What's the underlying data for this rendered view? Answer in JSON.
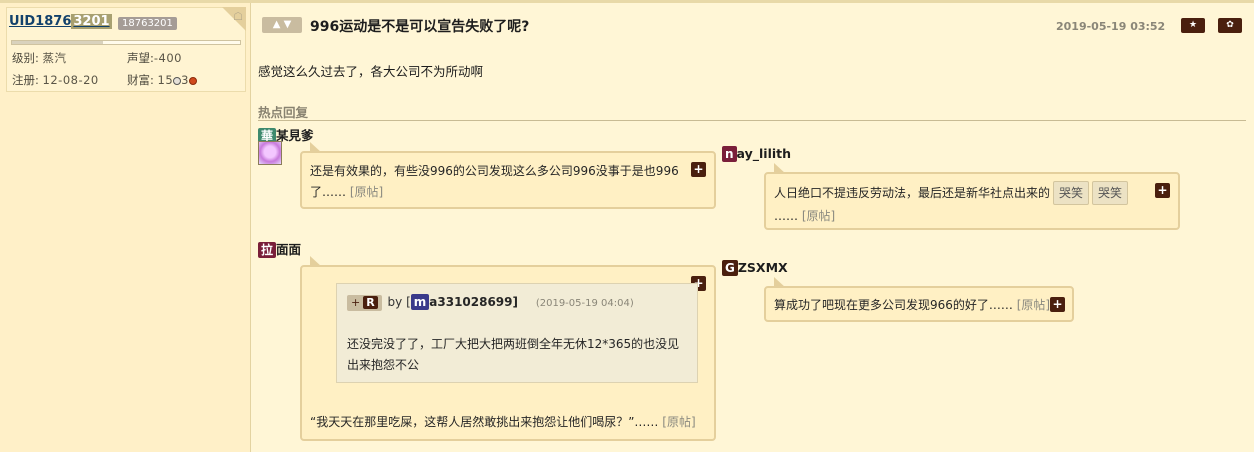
{
  "user": {
    "uid_prefix": "UID1876",
    "uid_highlight": "3201",
    "uid_badge": "18763201",
    "level_label": "级别:",
    "level_value": "蒸汽",
    "rep_label": "声望:",
    "rep_value": "-400",
    "reg_label": "注册:",
    "reg_value": "12-08-20",
    "wealth_label": "财富:",
    "wealth_a": "15",
    "wealth_b": "3",
    "exp_fraction": 0.4
  },
  "post": {
    "title": "996运动是不是可以宣告失败了呢?",
    "time": "2019-05-19 03:52",
    "content": "感觉这么久过去了，各大公司不为所动啊"
  },
  "hot_section": {
    "label": "热点回复"
  },
  "replies": [
    {
      "tag": "華",
      "tag_color": "#3e8a6e",
      "name": "某見爹",
      "text": "还是有效果的，有些没996的公司发现这么多公司996没事于是也996了……",
      "orig": "[原帖]"
    },
    {
      "tag": "n",
      "tag_color": "#7a1f3a",
      "name": "ay_lilith",
      "text": "人日绝口不提违反劳动法，最后还是新华社点出来的",
      "emo1": "哭笑",
      "emo2": "哭笑",
      "tail": "……",
      "orig": "[原帖]"
    },
    {
      "tag": "拉",
      "tag_color": "#7a1f3a",
      "name": "面面",
      "quote": {
        "plus": "+",
        "r": "R",
        "by": "by [",
        "tag": "m",
        "tag_color": "#3a3a8a",
        "user": "a331028699]",
        "time": "(2019-05-19 04:04)",
        "text": "还没完没了了，工厂大把大把两班倒全年无休12*365的也没见出来抱怨不公"
      },
      "text": "“我天天在那里吃屎，这帮人居然敢挑出来抱怨让他们喝尿？”……",
      "orig": "[原帖]"
    },
    {
      "tag": "G",
      "tag_color": "#4a1f0e",
      "name": "ZSXMX",
      "text": "算成功了吧现在更多公司发现966的好了……",
      "orig": "[原帖]"
    }
  ],
  "icons": {
    "plus": "+",
    "star": "★",
    "gear": "✿",
    "android": "☖"
  }
}
